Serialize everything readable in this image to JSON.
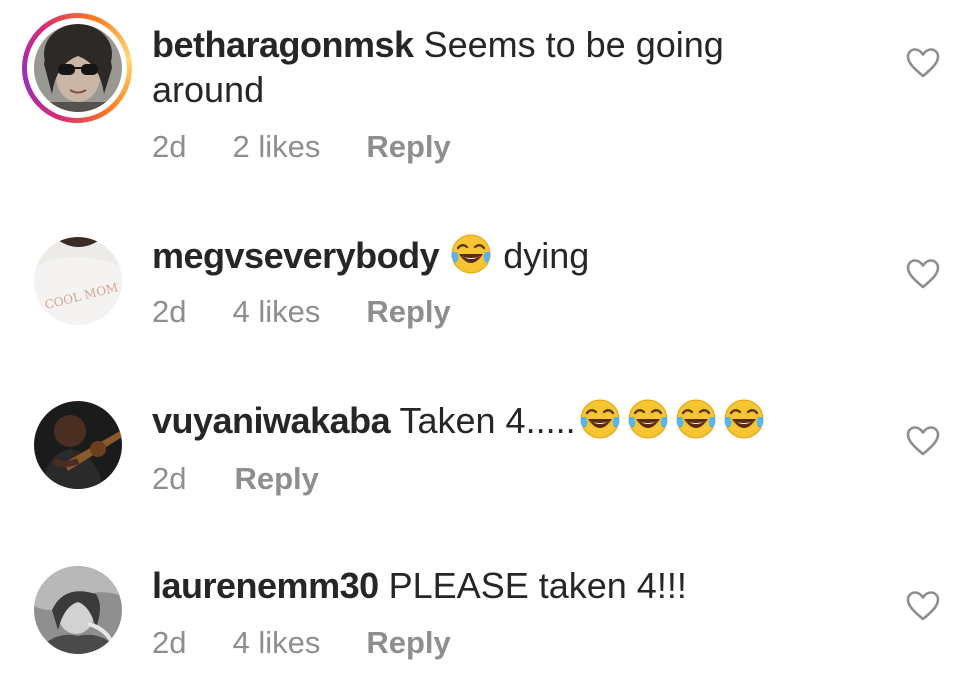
{
  "comments": [
    {
      "username": "betharagonmsk",
      "text_line1": "Seems to be going",
      "text_line2": "around",
      "time": "2d",
      "likes": "2 likes",
      "reply": "Reply",
      "has_story": true
    },
    {
      "username": "megvseverybody",
      "emoji_before": "face-with-tears-of-joy",
      "text": "dying",
      "time": "2d",
      "likes": "4 likes",
      "reply": "Reply"
    },
    {
      "username": "vuyaniwakaba",
      "text": "Taken 4.....",
      "emoji_after_count": 4,
      "emoji_after": "face-with-tears-of-joy",
      "time": "2d",
      "reply": "Reply"
    },
    {
      "username": "laurenemm30",
      "text": "PLEASE taken 4!!!",
      "time": "2d",
      "likes": "4 likes",
      "reply": "Reply"
    }
  ],
  "colors": {
    "text": "#262626",
    "meta": "#8e8e8e",
    "heart": "#8e8e8e"
  },
  "icons": {
    "like": "heart-outline-icon",
    "emoji": "face-with-tears-of-joy"
  }
}
